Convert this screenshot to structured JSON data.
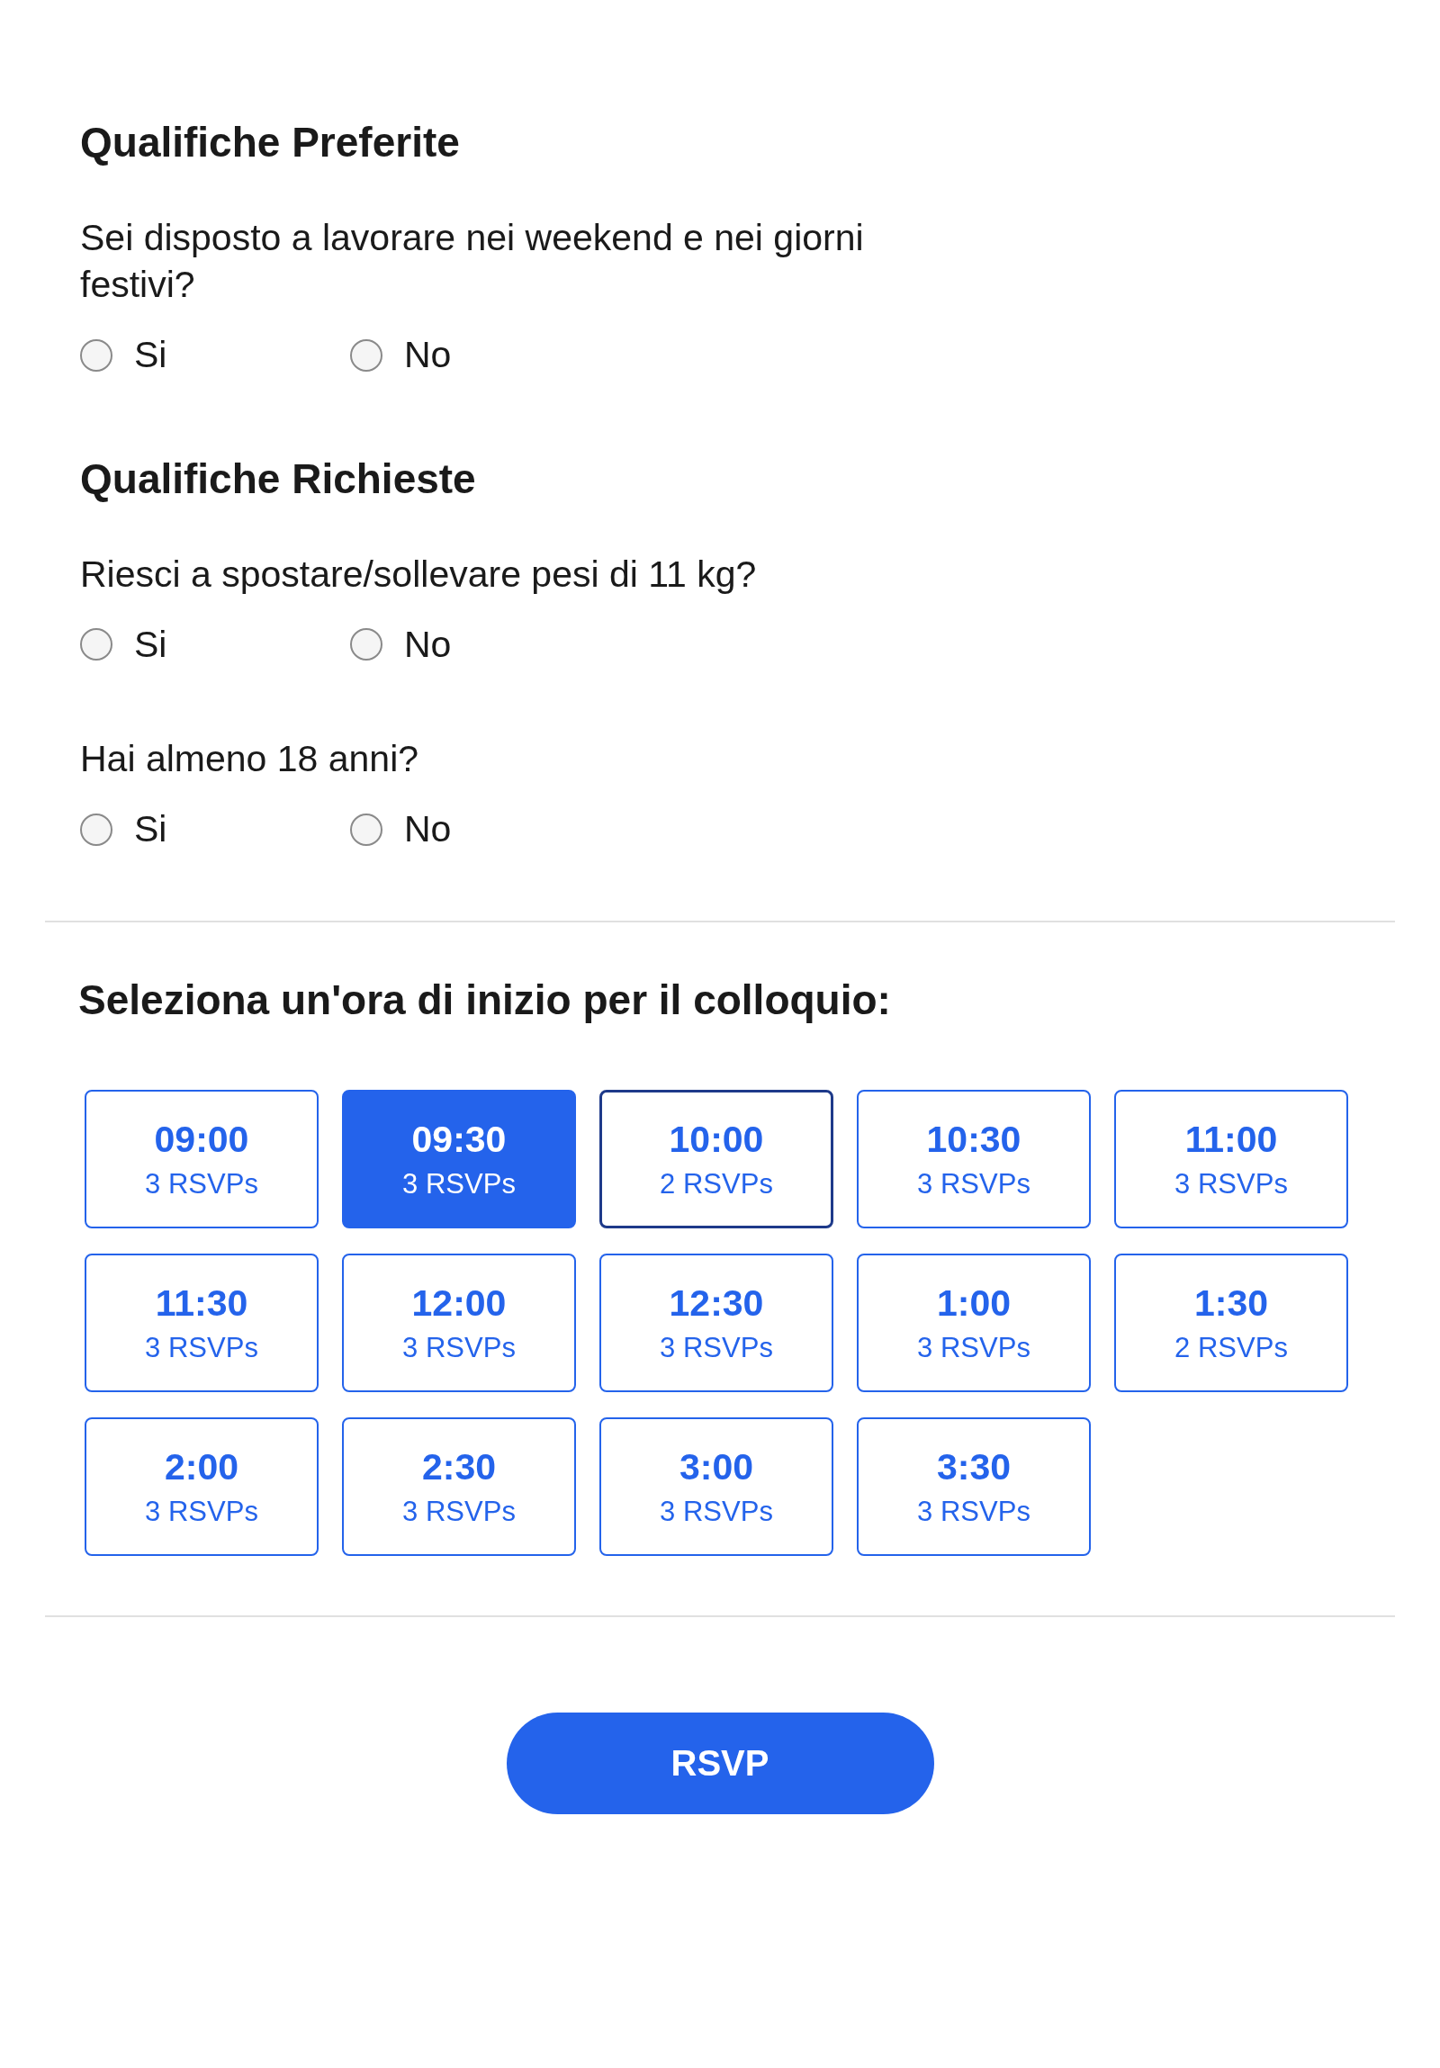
{
  "sections": [
    {
      "title": "Qualifiche Preferite",
      "questions": [
        {
          "text": "Sei disposto a lavorare nei weekend e nei giorni festivi?",
          "options": [
            {
              "label": "Si",
              "selected": false
            },
            {
              "label": "No",
              "selected": false
            }
          ]
        }
      ]
    },
    {
      "title": "Qualifiche Richieste",
      "questions": [
        {
          "text": "Riesci a spostare/sollevare pesi di 11 kg?",
          "options": [
            {
              "label": "Si",
              "selected": false
            },
            {
              "label": "No",
              "selected": false
            }
          ]
        },
        {
          "text": "Hai almeno 18 anni?",
          "options": [
            {
              "label": "Si",
              "selected": false
            },
            {
              "label": "No",
              "selected": false
            }
          ]
        }
      ]
    }
  ],
  "schedule": {
    "title": "Seleziona un'ora di inizio per il colloquio:",
    "slots": [
      {
        "time": "09:00",
        "count": "3 RSVPs",
        "selected": false,
        "focused": false
      },
      {
        "time": "09:30",
        "count": "3 RSVPs",
        "selected": true,
        "focused": false
      },
      {
        "time": "10:00",
        "count": "2 RSVPs",
        "selected": false,
        "focused": true
      },
      {
        "time": "10:30",
        "count": "3 RSVPs",
        "selected": false,
        "focused": false
      },
      {
        "time": "11:00",
        "count": "3 RSVPs",
        "selected": false,
        "focused": false
      },
      {
        "time": "11:30",
        "count": "3 RSVPs",
        "selected": false,
        "focused": false
      },
      {
        "time": "12:00",
        "count": "3 RSVPs",
        "selected": false,
        "focused": false
      },
      {
        "time": "12:30",
        "count": "3 RSVPs",
        "selected": false,
        "focused": false
      },
      {
        "time": "1:00",
        "count": "3 RSVPs",
        "selected": false,
        "focused": false
      },
      {
        "time": "1:30",
        "count": "2 RSVPs",
        "selected": false,
        "focused": false
      },
      {
        "time": "2:00",
        "count": "3 RSVPs",
        "selected": false,
        "focused": false
      },
      {
        "time": "2:30",
        "count": "3 RSVPs",
        "selected": false,
        "focused": false
      },
      {
        "time": "3:00",
        "count": "3 RSVPs",
        "selected": false,
        "focused": false
      },
      {
        "time": "3:30",
        "count": "3 RSVPs",
        "selected": false,
        "focused": false
      }
    ]
  },
  "submit": {
    "label": "RSVP"
  }
}
